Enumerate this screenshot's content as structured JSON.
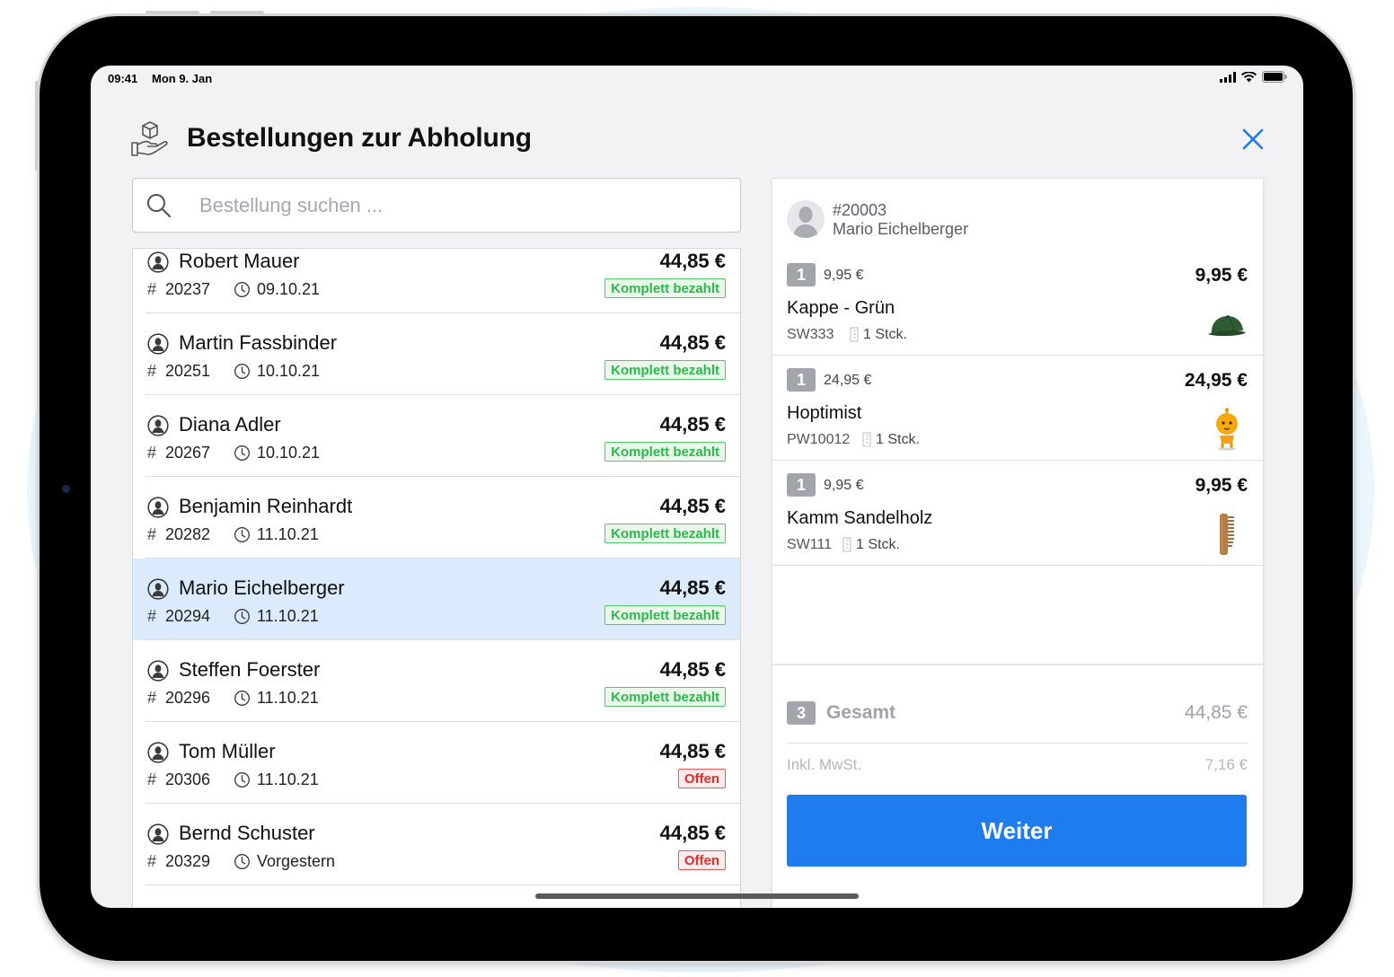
{
  "status_bar": {
    "time": "09:41",
    "date": "Mon 9. Jan"
  },
  "header": {
    "title": "Bestellungen zur Abholung",
    "close_icon": "close-icon",
    "title_icon": "hand-package-icon"
  },
  "search": {
    "placeholder": "Bestellung suchen ...",
    "value": ""
  },
  "orders": [
    {
      "customer": "Robert Mauer",
      "number": "20237",
      "date": "09.10.21",
      "amount": "44,85 €",
      "status": "Komplett bezahlt",
      "status_type": "paid"
    },
    {
      "customer": "Martin Fassbinder",
      "number": "20251",
      "date": "10.10.21",
      "amount": "44,85 €",
      "status": "Komplett bezahlt",
      "status_type": "paid"
    },
    {
      "customer": "Diana Adler",
      "number": "20267",
      "date": "10.10.21",
      "amount": "44,85 €",
      "status": "Komplett bezahlt",
      "status_type": "paid"
    },
    {
      "customer": "Benjamin Reinhardt",
      "number": "20282",
      "date": "11.10.21",
      "amount": "44,85 €",
      "status": "Komplett bezahlt",
      "status_type": "paid"
    },
    {
      "customer": "Mario Eichelberger",
      "number": "20294",
      "date": "11.10.21",
      "amount": "44,85 €",
      "status": "Komplett bezahlt",
      "status_type": "paid",
      "selected": true
    },
    {
      "customer": "Steffen Foerster",
      "number": "20296",
      "date": "11.10.21",
      "amount": "44,85 €",
      "status": "Komplett bezahlt",
      "status_type": "paid"
    },
    {
      "customer": "Tom Müller",
      "number": "20306",
      "date": "11.10.21",
      "amount": "44,85 €",
      "status": "Offen",
      "status_type": "open"
    },
    {
      "customer": "Bernd Schuster",
      "number": "20329",
      "date": "Vorgestern",
      "amount": "44,85 €",
      "status": "Offen",
      "status_type": "open"
    }
  ],
  "detail": {
    "order_number": "#20003",
    "customer": "Mario Eichelberger",
    "items": [
      {
        "qty": "1",
        "unit_price": "9,95 €",
        "total": "9,95 €",
        "name": "Kappe - Grün",
        "sku": "SW333",
        "stock": "1 Stck.",
        "image": "green-cap-image"
      },
      {
        "qty": "1",
        "unit_price": "24,95 €",
        "total": "24,95 €",
        "name": "Hoptimist",
        "sku": "PW10012",
        "stock": "1 Stck.",
        "image": "hoptimist-figure-image"
      },
      {
        "qty": "1",
        "unit_price": "9,95 €",
        "total": "9,95 €",
        "name": "Kamm Sandelholz",
        "sku": "SW111",
        "stock": "1 Stck.",
        "image": "wooden-comb-image"
      }
    ],
    "summary": {
      "qty": "3",
      "label": "Gesamt",
      "total": "44,85 €",
      "tax_label": "Inkl. MwSt.",
      "tax_value": "7,16 €"
    },
    "continue_label": "Weiter"
  },
  "colors": {
    "accent": "#1f7cef",
    "paid": "#2db84d",
    "open": "#e0302d",
    "selected_row": "#dcebfb"
  }
}
